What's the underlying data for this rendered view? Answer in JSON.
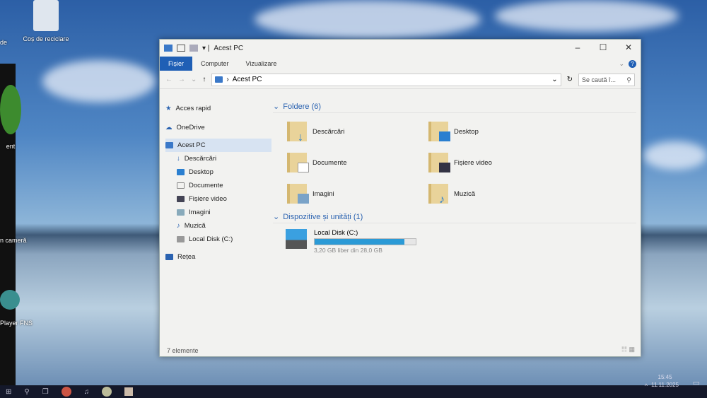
{
  "desktop": {
    "icons": [
      {
        "label": "Coș de reciclare"
      },
      {
        "label": "ent"
      },
      {
        "label": "n cameră"
      },
      {
        "label": "Player FNS"
      },
      {
        "label": "de"
      }
    ]
  },
  "window": {
    "title": "Acest PC",
    "ribbon_tabs": [
      "Fișier",
      "Computer",
      "Vizualizare"
    ],
    "address": "Acest PC",
    "search_placeholder": "Se caută î...",
    "nav": [
      "Acces rapid",
      "OneDrive",
      "Acest PC",
      "Descărcări",
      "Desktop",
      "Documente",
      "Fișiere video",
      "Imagini",
      "Muzică",
      "Local Disk (C:)",
      "Rețea"
    ],
    "folders_header": "Foldere (6)",
    "folders": [
      "Descărcări",
      "Desktop",
      "Documente",
      "Fișiere video",
      "Imagini",
      "Muzică"
    ],
    "devices_header": "Dispozitive și unități (1)",
    "disk": {
      "name": "Local Disk (C:)",
      "free": "3,20 GB liber din 28,0 GB",
      "used_percent": 88.6
    },
    "status": "7 elemente"
  },
  "taskbar": {
    "time": "15:45",
    "date": "11.11.2025"
  },
  "colors": {
    "accent": "#1f5fb5",
    "disk_fill": "#2b9ad6"
  }
}
